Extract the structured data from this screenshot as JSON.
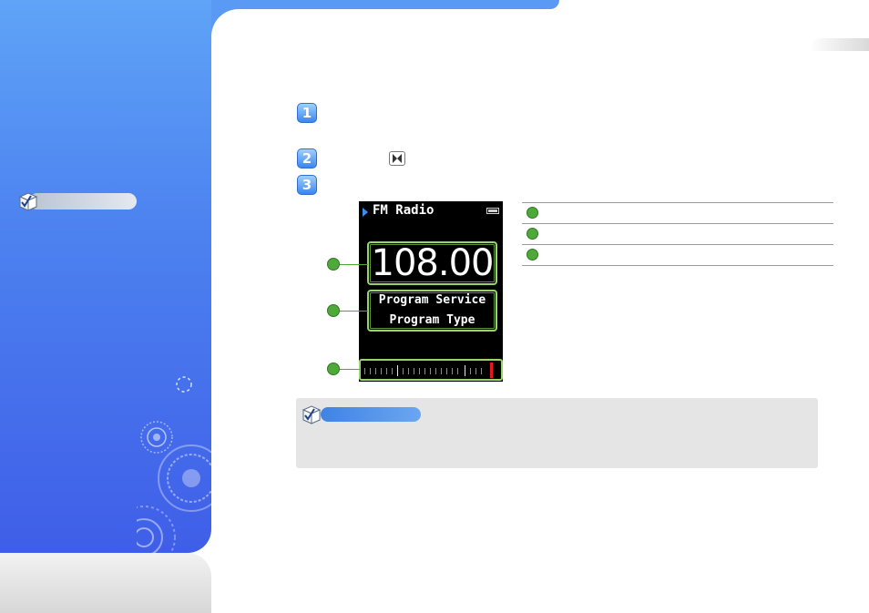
{
  "steps": [
    {
      "number": "1"
    },
    {
      "number": "2"
    },
    {
      "number": "3"
    }
  ],
  "icons": {
    "note_side": "checkbox-cube-icon",
    "note_main": "checkbox-cube-icon",
    "step2_button": "bowtie-button-icon",
    "decoration": "concentric-circles-icon"
  },
  "colors": {
    "panel_blue": "#4d83f0",
    "callout_green": "#4fa83a",
    "tuner_marker_red": "#e11b1b",
    "note_box_gray": "#e5e5e5"
  },
  "device": {
    "title": "FM Radio",
    "frequency": "108.00",
    "program_service": "Program Service",
    "program_type": "Program Type"
  },
  "legend_rows": 3
}
